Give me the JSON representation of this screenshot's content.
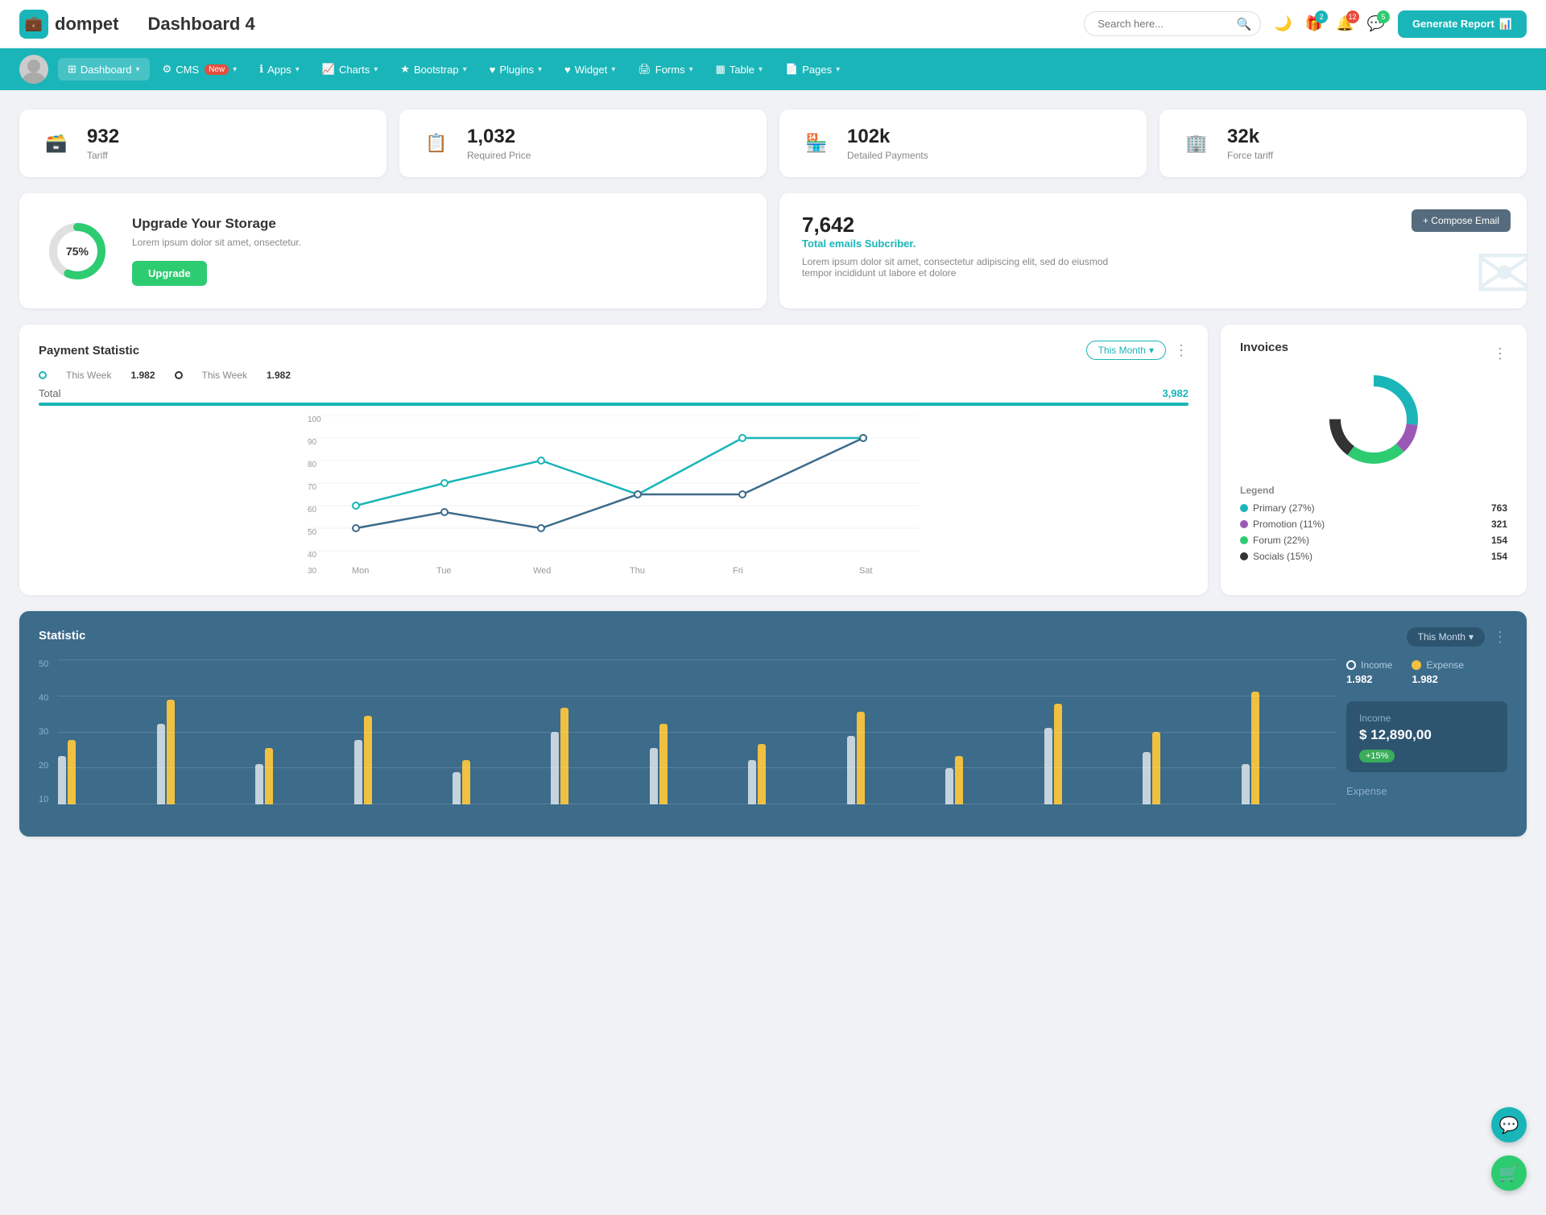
{
  "header": {
    "logo_text": "dompet",
    "page_title": "Dashboard 4",
    "search_placeholder": "Search here...",
    "generate_btn": "Generate Report",
    "icons": {
      "gift_badge": "2",
      "bell_badge": "12",
      "chat_badge": "5"
    }
  },
  "navbar": {
    "items": [
      {
        "label": "Dashboard",
        "has_arrow": true,
        "active": true
      },
      {
        "label": "CMS",
        "has_arrow": true,
        "badge": "New"
      },
      {
        "label": "Apps",
        "has_arrow": true
      },
      {
        "label": "Charts",
        "has_arrow": true
      },
      {
        "label": "Bootstrap",
        "has_arrow": true
      },
      {
        "label": "Plugins",
        "has_arrow": true
      },
      {
        "label": "Widget",
        "has_arrow": true
      },
      {
        "label": "Forms",
        "has_arrow": true
      },
      {
        "label": "Table",
        "has_arrow": true
      },
      {
        "label": "Pages",
        "has_arrow": true
      }
    ]
  },
  "stat_cards": [
    {
      "num": "932",
      "label": "Tariff",
      "icon": "🗃️",
      "color": "#1ab5b8"
    },
    {
      "num": "1,032",
      "label": "Required Price",
      "icon": "📋",
      "color": "#e74c3c"
    },
    {
      "num": "102k",
      "label": "Detailed Payments",
      "icon": "🏪",
      "color": "#9b59b6"
    },
    {
      "num": "32k",
      "label": "Force tariff",
      "icon": "🏢",
      "color": "#e91e8c"
    }
  ],
  "storage": {
    "percent": "75%",
    "title": "Upgrade Your Storage",
    "desc": "Lorem ipsum dolor sit amet, onsectetur.",
    "btn_label": "Upgrade",
    "donut_value": 75
  },
  "email": {
    "num": "7,642",
    "sub": "Total emails Subcriber.",
    "desc": "Lorem ipsum dolor sit amet, consectetur adipiscing elit, sed do eiusmod tempor incididunt ut labore et dolore",
    "compose_btn": "+ Compose Email"
  },
  "payment": {
    "title": "Payment Statistic",
    "this_month": "This Month",
    "legend": [
      {
        "label": "This Week",
        "val": "1.982",
        "color": "teal"
      },
      {
        "label": "This Week",
        "val": "1.982",
        "color": "dark"
      }
    ],
    "total_label": "Total",
    "total_val": "3,982",
    "x_labels": [
      "Mon",
      "Tue",
      "Wed",
      "Thu",
      "Fri",
      "Sat"
    ],
    "y_labels": [
      "100",
      "90",
      "80",
      "70",
      "60",
      "50",
      "40",
      "30"
    ]
  },
  "invoices": {
    "title": "Invoices",
    "legend_title": "Legend",
    "items": [
      {
        "label": "Primary (27%)",
        "color": "#1ab5b8",
        "val": "763"
      },
      {
        "label": "Promotion (11%)",
        "color": "#9b59b6",
        "val": "321"
      },
      {
        "label": "Forum (22%)",
        "color": "#2ecc71",
        "val": "154"
      },
      {
        "label": "Socials (15%)",
        "color": "#333",
        "val": "154"
      }
    ]
  },
  "statistic": {
    "title": "Statistic",
    "this_month": "This Month",
    "y_labels": [
      "50",
      "40",
      "30",
      "20",
      "10"
    ],
    "income": {
      "label": "Income",
      "val": "1.982"
    },
    "expense": {
      "label": "Expense",
      "val": "1.982"
    },
    "income_box": {
      "label": "Income",
      "val": "$ 12,890,00",
      "change": "+15%"
    },
    "expense_label": "Expense"
  },
  "month_dropdown": "Month"
}
